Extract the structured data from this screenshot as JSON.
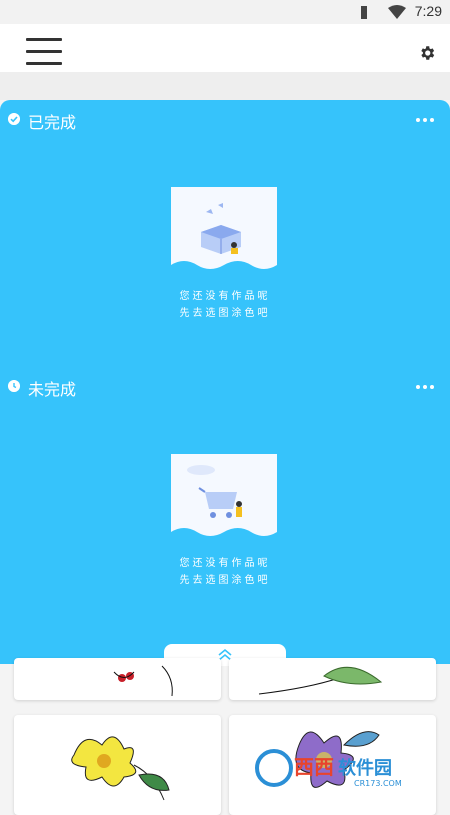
{
  "status_bar": {
    "time": "7:29",
    "wifi_icon": "wifi-icon",
    "battery_icon": "battery-icon"
  },
  "app_bar": {
    "menu_icon": "menu-icon",
    "settings_icon": "gear-icon"
  },
  "sections": [
    {
      "title": "已完成",
      "status_icon": "check-circle-icon",
      "more_icon": "more-horizontal-icon",
      "empty_line1": "您还没有作品呢",
      "empty_line2": "先去选图涂色吧",
      "illustration": "empty-box-icon"
    },
    {
      "title": "未完成",
      "status_icon": "clock-circle-icon",
      "more_icon": "more-horizontal-icon",
      "empty_line1": "您还没有作品呢",
      "empty_line2": "先去选图涂色吧",
      "illustration": "empty-cart-icon"
    }
  ],
  "collapse_icon": "double-chevron-up-icon",
  "gallery": [
    "coloring-card-ladybug-flower",
    "coloring-card-leaf-branch",
    "coloring-card-yellow-lily",
    "coloring-card-purple-flower"
  ],
  "watermark": {
    "text": "西西软件园",
    "sub": "CR173.COM"
  },
  "colors": {
    "panel": "#36c3fb",
    "background": "#f4f4f4"
  }
}
